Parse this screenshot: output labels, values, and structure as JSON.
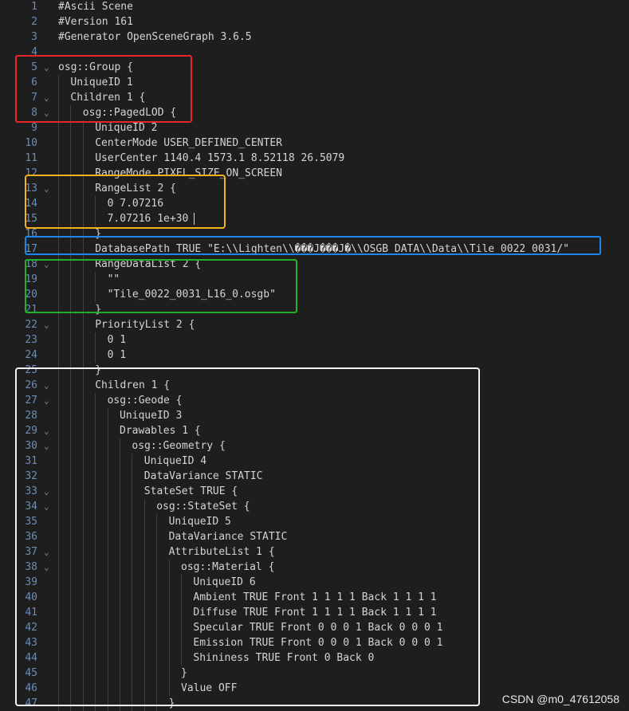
{
  "editor": {
    "lines": [
      {
        "n": "1",
        "indent": 0,
        "text": "#Ascii Scene",
        "fold": false
      },
      {
        "n": "2",
        "indent": 0,
        "text": "#Version 161",
        "fold": false
      },
      {
        "n": "3",
        "indent": 0,
        "text": "#Generator OpenSceneGraph 3.6.5",
        "fold": false
      },
      {
        "n": "4",
        "indent": 0,
        "text": "",
        "fold": false
      },
      {
        "n": "5",
        "indent": 0,
        "text": "osg::Group {",
        "fold": true
      },
      {
        "n": "6",
        "indent": 1,
        "text": "UniqueID 1",
        "fold": false
      },
      {
        "n": "7",
        "indent": 1,
        "text": "Children 1 {",
        "fold": true
      },
      {
        "n": "8",
        "indent": 2,
        "text": "osg::PagedLOD {",
        "fold": true
      },
      {
        "n": "9",
        "indent": 3,
        "text": "UniqueID 2",
        "fold": false
      },
      {
        "n": "10",
        "indent": 3,
        "text": "CenterMode USER_DEFINED_CENTER",
        "fold": false
      },
      {
        "n": "11",
        "indent": 3,
        "text": "UserCenter 1140.4 1573.1 8.52118 26.5079",
        "fold": false
      },
      {
        "n": "12",
        "indent": 3,
        "text": "RangeMode PIXEL_SIZE_ON_SCREEN",
        "fold": false
      },
      {
        "n": "13",
        "indent": 3,
        "text": "RangeList 2 {",
        "fold": true
      },
      {
        "n": "14",
        "indent": 4,
        "text": "0 7.07216",
        "fold": false
      },
      {
        "n": "15",
        "indent": 4,
        "text": "7.07216 1e+30",
        "fold": false,
        "cursor": true
      },
      {
        "n": "16",
        "indent": 3,
        "text": "}",
        "fold": false
      },
      {
        "n": "17",
        "indent": 3,
        "text": "DatabasePath TRUE \"E:\\\\Lighten\\\\���J���J�\\\\OSGB_DATA\\\\Data\\\\Tile_0022_0031/\"",
        "fold": false
      },
      {
        "n": "18",
        "indent": 3,
        "text": "RangeDataList 2 {",
        "fold": true
      },
      {
        "n": "19",
        "indent": 4,
        "text": "\"\"",
        "fold": false
      },
      {
        "n": "20",
        "indent": 4,
        "text": "\"Tile_0022_0031_L16_0.osgb\"",
        "fold": false
      },
      {
        "n": "21",
        "indent": 3,
        "text": "}",
        "fold": false
      },
      {
        "n": "22",
        "indent": 3,
        "text": "PriorityList 2 {",
        "fold": true
      },
      {
        "n": "23",
        "indent": 4,
        "text": "0 1",
        "fold": false
      },
      {
        "n": "24",
        "indent": 4,
        "text": "0 1",
        "fold": false
      },
      {
        "n": "25",
        "indent": 3,
        "text": "}",
        "fold": false
      },
      {
        "n": "26",
        "indent": 3,
        "text": "Children 1 {",
        "fold": true
      },
      {
        "n": "27",
        "indent": 4,
        "text": "osg::Geode {",
        "fold": true
      },
      {
        "n": "28",
        "indent": 5,
        "text": "UniqueID 3",
        "fold": false
      },
      {
        "n": "29",
        "indent": 5,
        "text": "Drawables 1 {",
        "fold": true
      },
      {
        "n": "30",
        "indent": 6,
        "text": "osg::Geometry {",
        "fold": true
      },
      {
        "n": "31",
        "indent": 7,
        "text": "UniqueID 4",
        "fold": false
      },
      {
        "n": "32",
        "indent": 7,
        "text": "DataVariance STATIC",
        "fold": false
      },
      {
        "n": "33",
        "indent": 7,
        "text": "StateSet TRUE {",
        "fold": true
      },
      {
        "n": "34",
        "indent": 8,
        "text": "osg::StateSet {",
        "fold": true
      },
      {
        "n": "35",
        "indent": 9,
        "text": "UniqueID 5",
        "fold": false
      },
      {
        "n": "36",
        "indent": 9,
        "text": "DataVariance STATIC",
        "fold": false
      },
      {
        "n": "37",
        "indent": 9,
        "text": "AttributeList 1 {",
        "fold": true
      },
      {
        "n": "38",
        "indent": 10,
        "text": "osg::Material {",
        "fold": true
      },
      {
        "n": "39",
        "indent": 11,
        "text": "UniqueID 6",
        "fold": false
      },
      {
        "n": "40",
        "indent": 11,
        "text": "Ambient TRUE Front 1 1 1 1 Back 1 1 1 1",
        "fold": false
      },
      {
        "n": "41",
        "indent": 11,
        "text": "Diffuse TRUE Front 1 1 1 1 Back 1 1 1 1",
        "fold": false
      },
      {
        "n": "42",
        "indent": 11,
        "text": "Specular TRUE Front 0 0 0 1 Back 0 0 0 1",
        "fold": false
      },
      {
        "n": "43",
        "indent": 11,
        "text": "Emission TRUE Front 0 0 0 1 Back 0 0 0 1",
        "fold": false
      },
      {
        "n": "44",
        "indent": 11,
        "text": "Shininess TRUE Front 0 Back 0",
        "fold": false
      },
      {
        "n": "45",
        "indent": 10,
        "text": "}",
        "fold": false
      },
      {
        "n": "46",
        "indent": 10,
        "text": "Value OFF",
        "fold": false
      },
      {
        "n": "47",
        "indent": 9,
        "text": "}",
        "fold": false
      }
    ],
    "fold_icon": "chevron-down-icon",
    "colors": {
      "background": "#1e1e1e",
      "text": "#d4d4d4",
      "line_number": "#6b8db5",
      "box_red": "#e8252a",
      "box_yellow": "#f3b21b",
      "box_blue": "#1c86ee",
      "box_green": "#22b02a",
      "box_white": "#f2f2f2"
    }
  },
  "watermark": "CSDN @m0_47612058"
}
